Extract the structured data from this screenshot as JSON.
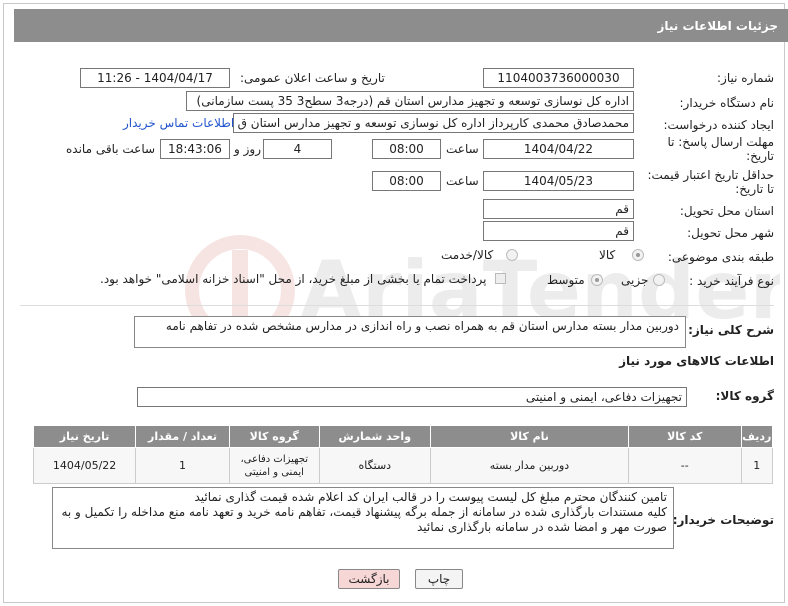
{
  "header": {
    "title": "جزئیات اطلاعات نیاز"
  },
  "form": {
    "need_number_label": "شماره نیاز:",
    "need_number": "1104003736000030",
    "announce_label": "تاریخ و ساعت اعلان عمومی:",
    "announce_value": "1404/04/17 - 11:26",
    "buyer_org_label": "نام دستگاه خریدار:",
    "buyer_org": "اداره کل نوسازی   توسعه و تجهیز مدارس استان قم (درجه3 سطح3  35 پست سازمانی)",
    "creator_label": "ایجاد کننده درخواست:",
    "creator": "محمدصادق محمدی کارپرداز  اداره کل نوسازی   توسعه و تجهیز مدارس استان ق",
    "contact_link": "اطلاعات تماس خریدار",
    "deadline_label": "مهلت ارسال پاسخ: تا تاریخ:",
    "deadline_date": "1404/04/22",
    "hour_label": "ساعت",
    "deadline_hour": "08:00",
    "days_value": "4",
    "days_label": "روز و",
    "remaining_time": "18:43:06",
    "remaining_label": "ساعت باقی مانده",
    "validity_label": "حداقل تاریخ اعتبار قیمت: تا تاریخ:",
    "validity_date": "1404/05/23",
    "validity_hour": "08:00",
    "province_label": "استان محل تحویل:",
    "province": "قم",
    "city_label": "شهر محل تحویل:",
    "city": "قم",
    "category_label": "طبقه بندی موضوعی:",
    "category_options": [
      "کالا",
      "کالا/خدمت"
    ],
    "process_label": "نوع فرآیند خرید :",
    "process_options": [
      "جزیی",
      "متوسط"
    ],
    "payment_note": "پرداخت تمام یا بخشی از مبلغ خرید، از محل \"اسناد خزانه اسلامی\" خواهد بود.",
    "desc_label": "شرح کلی نیاز:",
    "desc": "دوربین مدار بسته مدارس استان قم به همراه نصب و راه اندازی در مدارس مشخص شده در تفاهم نامه",
    "goods_info_title": "اطلاعات کالاهای مورد نیاز",
    "goods_group_label": "گروه کالا:",
    "goods_group": "تجهیزات دفاعی، ایمنی و امنیتی",
    "buyer_notes_label": "توضیحات خریدار:",
    "buyer_notes": "تامین کنندگان محترم مبلغ کل لیست پیوست را در قالب ایران کد اعلام شده قیمت گذاری نمائید\nکلیه مستندات بارگذاری شده در سامانه از جمله برگه پیشنهاد قیمت، تفاهم نامه خرید و تعهد نامه منع مداخله را تکمیل و به صورت مهر و امضا شده در سامانه بارگذاری نمائید"
  },
  "table": {
    "headers": [
      "ردیف",
      "کد کالا",
      "نام کالا",
      "واحد شمارش",
      "گروه کالا",
      "تعداد / مقدار",
      "تاریخ نیاز"
    ],
    "rows": [
      [
        "1",
        "--",
        "دوربین مدار بسته",
        "دستگاه",
        "تجهیزات دفاعی، ایمنی و امنیتی",
        "1",
        "1404/05/22"
      ]
    ]
  },
  "buttons": {
    "print": "چاپ",
    "back": "بازگشت"
  },
  "watermark_text": "AriaTender.neT"
}
